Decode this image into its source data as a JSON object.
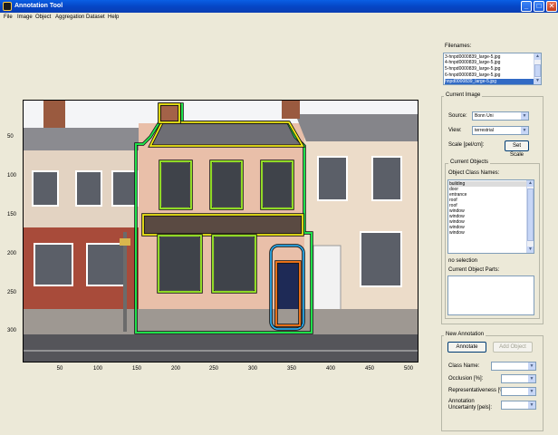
{
  "window": {
    "title": "Annotation Tool",
    "minimize": "_",
    "maximize": "□",
    "close": "✕"
  },
  "menu": [
    "File",
    "Image",
    "Object",
    "Aggregation",
    "Dataset",
    "Help"
  ],
  "plot": {
    "y_ticks": [
      "50",
      "100",
      "150",
      "200",
      "250",
      "300"
    ],
    "x_ticks": [
      "50",
      "100",
      "150",
      "200",
      "250",
      "300",
      "350",
      "400",
      "450",
      "500"
    ]
  },
  "filenames": {
    "label": "Filenames:",
    "items": [
      "3-hnpd0000839_large-5.jpg",
      "4-hnpd0000839_large-5.jpg",
      "5-hnpd0000839_large-5.jpg",
      "6-hnpd0000839_large-5.jpg",
      "hnpd0000839_large-5.jpg"
    ],
    "selected_index": 4
  },
  "current_image": {
    "title": "Current Image",
    "source_label": "Source:",
    "source_value": "Bonn Uni",
    "view_label": "View:",
    "view_value": "terrestrial",
    "scale_label": "Scale [pel/cm]:",
    "set_scale": "Set Scale"
  },
  "current_objects": {
    "title": "Current Objects",
    "class_names_label": "Object Class Names:",
    "items": [
      "building",
      "door",
      "entrance",
      "roof",
      "roof",
      "window",
      "window",
      "window",
      "window",
      "window"
    ],
    "selected_index": 0,
    "selection_status": "no selection",
    "parts_label": "Current Object Parts:"
  },
  "new_annotation": {
    "title": "New Annotation",
    "annotate": "Annotate",
    "add_object": "Add Object",
    "class_name_label": "Class Name:",
    "occlusion_label": "Occlusion [%]:",
    "representativeness_label": "Representativeness [%]:",
    "uncertainty_label_1": "Annotation",
    "uncertainty_label_2": "Uncertainty [pels]:"
  },
  "colors": {
    "titlebar": "#0546c6",
    "building_outline": "#1fe04a",
    "window_outline": "#9ef028",
    "roof_outline": "#f2ea16",
    "door_outline": "#ff7a1a",
    "entrance_outline": "#2aa8e8",
    "selection": "#316ac5"
  },
  "icons": {
    "app": "matlab-icon",
    "dropdown": "chevron-down-icon"
  }
}
